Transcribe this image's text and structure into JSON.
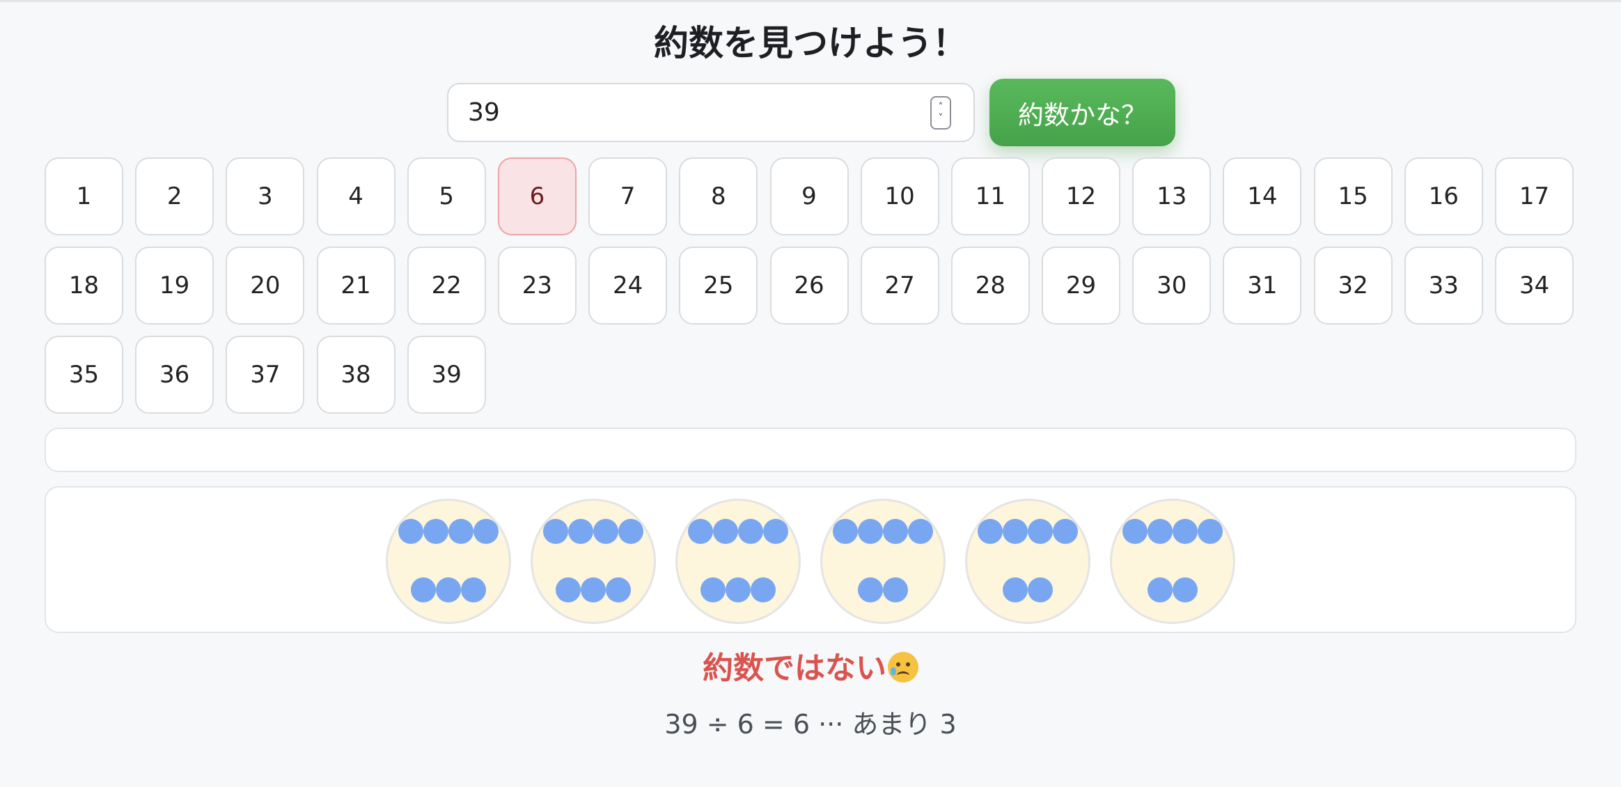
{
  "title": "約数を見つけよう！",
  "input": {
    "value": "39",
    "spinner_up": "˄",
    "spinner_down": "˅"
  },
  "check_button": {
    "label": "約数かな？"
  },
  "numbers": [
    "1",
    "2",
    "3",
    "4",
    "5",
    "6",
    "7",
    "8",
    "9",
    "10",
    "11",
    "12",
    "13",
    "14",
    "15",
    "16",
    "17",
    "18",
    "19",
    "20",
    "21",
    "22",
    "23",
    "24",
    "25",
    "26",
    "27",
    "28",
    "29",
    "30",
    "31",
    "32",
    "33",
    "34",
    "35",
    "36",
    "37",
    "38",
    "39"
  ],
  "selected_number": "6",
  "groups": {
    "count": 6,
    "dots_per_plate": [
      7,
      7,
      7,
      6,
      6,
      6
    ],
    "dot_color": "#78a6f0",
    "plate_color": "#fdf5dc"
  },
  "result": {
    "text": "約数ではない",
    "icon": "crying-face-icon",
    "color": "#d9534f"
  },
  "equation": {
    "text": "39 ÷ 6 = 6 ··· あまり 3"
  },
  "colors": {
    "accent": "#4caf50",
    "selected_bg": "#f9e3e4",
    "selected_border": "#eda3a6"
  }
}
